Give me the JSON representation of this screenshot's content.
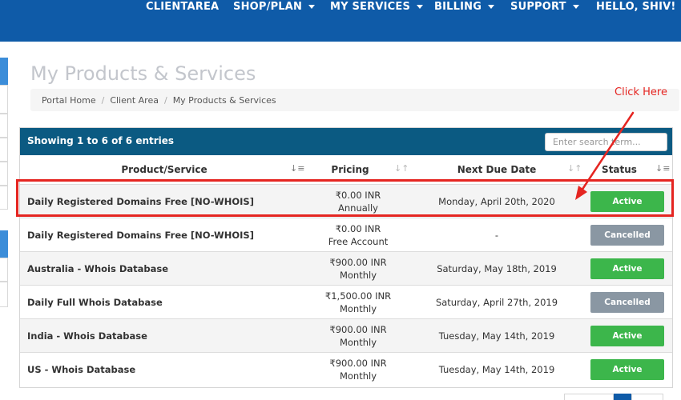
{
  "nav": {
    "items": [
      {
        "label": "CLIENTAREA",
        "caret": false
      },
      {
        "label": "SHOP/PLAN",
        "caret": true
      },
      {
        "label": "MY SERVICES",
        "caret": true
      },
      {
        "label": "BILLING",
        "caret": true
      },
      {
        "label": "SUPPORT",
        "caret": true
      },
      {
        "label": "HELLO, SHIV!",
        "caret": true
      }
    ]
  },
  "page": {
    "title": "My Products & Services",
    "breadcrumb": [
      "Portal Home",
      "Client Area",
      "My Products & Services"
    ]
  },
  "annotation": {
    "text": "Click Here",
    "color": "#e52521"
  },
  "table": {
    "info": "Showing 1 to 6 of 6 entries",
    "search_placeholder": "Enter search term...",
    "columns": [
      "Product/Service",
      "Pricing",
      "Next Due Date",
      "Status"
    ],
    "rows": [
      {
        "product": "Daily Registered Domains Free [NO-WHOIS]",
        "price": "₹0.00 INR",
        "cycle": "Annually",
        "due": "Monday, April 20th, 2020",
        "status": "Active"
      },
      {
        "product": "Daily Registered Domains Free [NO-WHOIS]",
        "price": "₹0.00 INR",
        "cycle": "Free Account",
        "due": "-",
        "status": "Cancelled"
      },
      {
        "product": "Australia - Whois Database",
        "price": "₹900.00 INR",
        "cycle": "Monthly",
        "due": "Saturday, May 18th, 2019",
        "status": "Active"
      },
      {
        "product": "Daily Full Whois Database",
        "price": "₹1,500.00 INR",
        "cycle": "Monthly",
        "due": "Saturday, April 27th, 2019",
        "status": "Cancelled"
      },
      {
        "product": "India - Whois Database",
        "price": "₹900.00 INR",
        "cycle": "Monthly",
        "due": "Tuesday, May 14th, 2019",
        "status": "Active"
      },
      {
        "product": "US - Whois Database",
        "price": "₹900.00 INR",
        "cycle": "Monthly",
        "due": "Tuesday, May 14th, 2019",
        "status": "Active"
      }
    ]
  },
  "colors": {
    "navbar": "#0f5ba8",
    "panel_header": "#0b5a82",
    "active": "#3cb64b",
    "cancelled": "#8a97a3",
    "highlight": "#e52521"
  },
  "icons": [
    "sort-icon",
    "caret-down-icon",
    "arrow-annotation-icon"
  ]
}
